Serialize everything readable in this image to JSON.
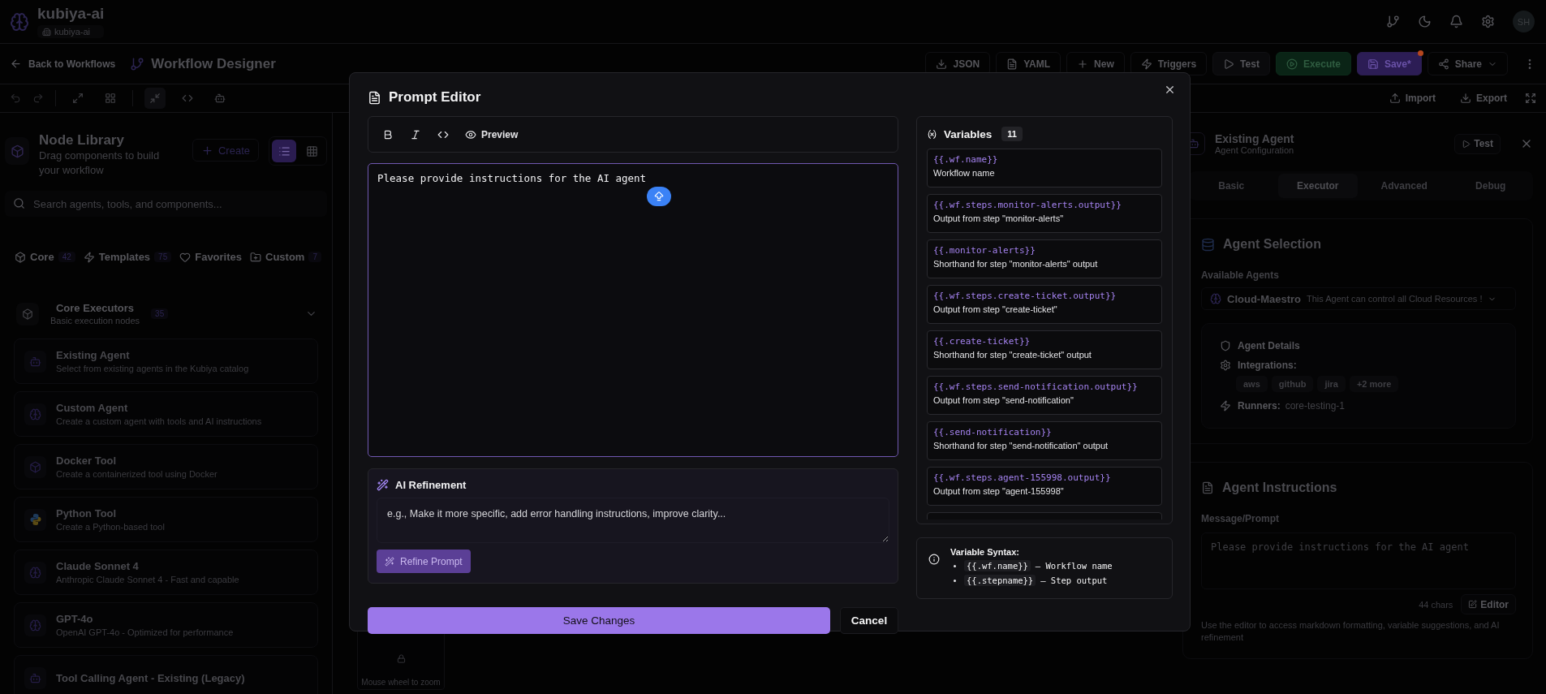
{
  "header": {
    "workspace": "kubiya-ai",
    "org_badge": "kubiya-ai",
    "avatar": "SH"
  },
  "toolbar": {
    "back_link": "Back to Workflows",
    "title": "Workflow Designer",
    "actions": [
      {
        "label": "JSON",
        "kind": "download"
      },
      {
        "label": "YAML",
        "kind": "file"
      },
      {
        "label": "New",
        "kind": "new"
      },
      {
        "label": "Triggers",
        "kind": "triggers"
      },
      {
        "label": "Test",
        "kind": "test"
      },
      {
        "label": "Execute",
        "kind": "execute"
      },
      {
        "label": "Save*",
        "kind": "save",
        "unsaved": true
      },
      {
        "label": "Share",
        "kind": "share"
      }
    ]
  },
  "canvas_tools": {
    "import": "Import",
    "export": "Export"
  },
  "node_library": {
    "title": "Node Library",
    "subtitle": "Drag components to build your workflow",
    "create": "Create",
    "views": [
      {
        "kind": "list",
        "selected": true
      },
      {
        "kind": "grid",
        "selected": false
      }
    ],
    "search": {
      "placeholder": "Search agents, tools, and components..."
    },
    "tabs": [
      {
        "label": "Core",
        "kind": "core",
        "count": "42"
      },
      {
        "label": "Templates",
        "kind": "templates",
        "count": "75"
      },
      {
        "label": "Favorites",
        "kind": "favorites"
      },
      {
        "label": "Custom",
        "kind": "custom",
        "count": "7"
      }
    ],
    "group": {
      "title": "Core Executors",
      "subtitle": "Basic execution nodes",
      "count": "35",
      "expanded": true
    },
    "items": [
      {
        "kind": "robot",
        "title": "Existing Agent",
        "description": "Select from existing agents in the Kubiya catalog"
      },
      {
        "kind": "brain",
        "title": "Custom Agent",
        "description": "Create a custom agent with tools and AI instructions"
      },
      {
        "kind": "cube",
        "title": "Docker Tool",
        "description": "Create a containerized tool using Docker"
      },
      {
        "kind": "python",
        "title": "Python Tool",
        "description": "Create a Python-based tool"
      },
      {
        "kind": "brain",
        "title": "Claude Sonnet 4",
        "description": "Anthropic Claude Sonnet 4 - Fast and capable"
      },
      {
        "kind": "brain",
        "title": "GPT-4o",
        "description": "OpenAI GPT-4o - Optimized for performance"
      },
      {
        "kind": "robot",
        "title": "Tool Calling Agent - Existing (Legacy)"
      }
    ]
  },
  "canvas": {
    "hint": "Mouse wheel to zoom"
  },
  "properties": {
    "title": "Existing Agent",
    "subtitle": "Agent Configuration",
    "test": "Test",
    "tabs": [
      {
        "label": "Basic",
        "selected": false
      },
      {
        "label": "Executor",
        "selected": true
      },
      {
        "label": "Advanced",
        "selected": false
      },
      {
        "label": "Debug",
        "selected": false
      }
    ],
    "selection": {
      "title": "Agent Selection",
      "label": "Available Agents",
      "agent": "Cloud-Maestro",
      "agent_description": "This Agent can control all Cloud Resources !",
      "details_title": "Agent Details",
      "integrations_label": "Integrations:",
      "integrations": [
        "aws",
        "github",
        "jira",
        "+2 more"
      ],
      "runners_label": "Runners:",
      "runners": "core-testing-1"
    },
    "instructions": {
      "title": "Agent Instructions",
      "label": "Message/Prompt",
      "value": "Please provide instructions for the AI agent",
      "char_count": "44 chars",
      "editor": "Editor",
      "help": "Use the editor to access markdown formatting, variable suggestions, and AI refinement"
    }
  },
  "modal": {
    "title": "Prompt Editor",
    "format_tools": [
      {
        "kind": "bold"
      },
      {
        "kind": "italic"
      },
      {
        "kind": "code"
      },
      {
        "kind": "preview",
        "label": "Preview"
      }
    ],
    "value": "Please provide instructions for the AI agent",
    "refinement": {
      "title": "AI Refinement",
      "placeholder": "e.g., Make it more specific, add error handling instructions, improve clarity...",
      "button": "Refine Prompt",
      "disabled": true
    },
    "save": "Save Changes",
    "cancel": "Cancel",
    "variables": {
      "title": "Variables",
      "count": "11",
      "items": [
        {
          "name": "{{.wf.name}}",
          "description": "Workflow name"
        },
        {
          "name": "{{.wf.steps.monitor-alerts.output}}",
          "description": "Output from step \"monitor-alerts\""
        },
        {
          "name": "{{.monitor-alerts}}",
          "description": "Shorthand for step \"monitor-alerts\" output"
        },
        {
          "name": "{{.wf.steps.create-ticket.output}}",
          "description": "Output from step \"create-ticket\""
        },
        {
          "name": "{{.create-ticket}}",
          "description": "Shorthand for step \"create-ticket\" output"
        },
        {
          "name": "{{.wf.steps.send-notification.output}}",
          "description": "Output from step \"send-notification\""
        },
        {
          "name": "{{.send-notification}}",
          "description": "Shorthand for step \"send-notification\" output"
        },
        {
          "name": "{{.wf.steps.agent-155998.output}}",
          "description": "Output from step \"agent-155998\""
        }
      ]
    },
    "syntax": {
      "title": "Variable Syntax:",
      "items": [
        {
          "code": "{{.wf.name}}",
          "text": "– Workflow name"
        },
        {
          "code": "{{.stepname}}",
          "text": "– Step output"
        }
      ]
    }
  }
}
